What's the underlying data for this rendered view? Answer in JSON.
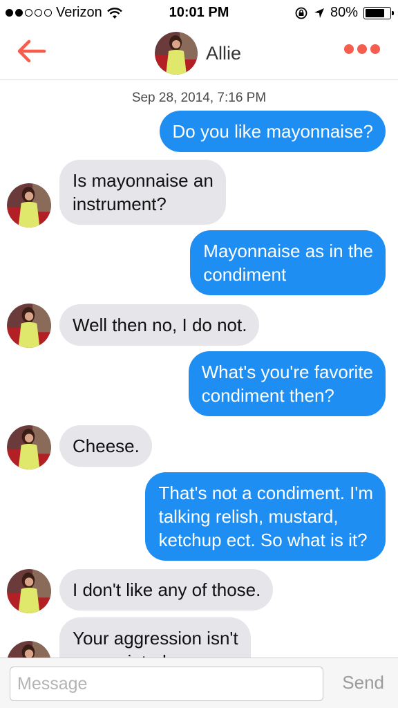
{
  "status_bar": {
    "carrier": "Verizon",
    "time": "10:01 PM",
    "battery": "80%",
    "battery_level": 0.8,
    "signal_bars_filled": 2,
    "signal_bars_total": 5
  },
  "header": {
    "contact_name": "Allie",
    "back_icon": "back-arrow-icon",
    "more_icon": "more-dots-icon",
    "accent_color": "#f55d4e"
  },
  "conversation": {
    "timestamp": "Sep 28, 2014, 7:16 PM",
    "messages": [
      {
        "direction": "out",
        "text": "Do you like mayonnaise?"
      },
      {
        "direction": "in",
        "text": "Is mayonnaise an\ninstrument?"
      },
      {
        "direction": "out",
        "text": "Mayonnaise as in the\ncondiment"
      },
      {
        "direction": "in",
        "text": "Well then no, I do not."
      },
      {
        "direction": "out",
        "text": "What's you're favorite\ncondiment then?"
      },
      {
        "direction": "in",
        "text": "Cheese."
      },
      {
        "direction": "out",
        "text": "That's not a condiment. I'm\ntalking relish, mustard,\nketchup ect. So what is it?"
      },
      {
        "direction": "in",
        "text": "I don't like any of those."
      },
      {
        "direction": "in",
        "text": "Your aggression isn't\nappreciated."
      }
    ],
    "outgoing_color": "#1e8ef3",
    "incoming_color": "#e5e5ea"
  },
  "composer": {
    "placeholder": "Message",
    "value": "",
    "send_label": "Send"
  }
}
